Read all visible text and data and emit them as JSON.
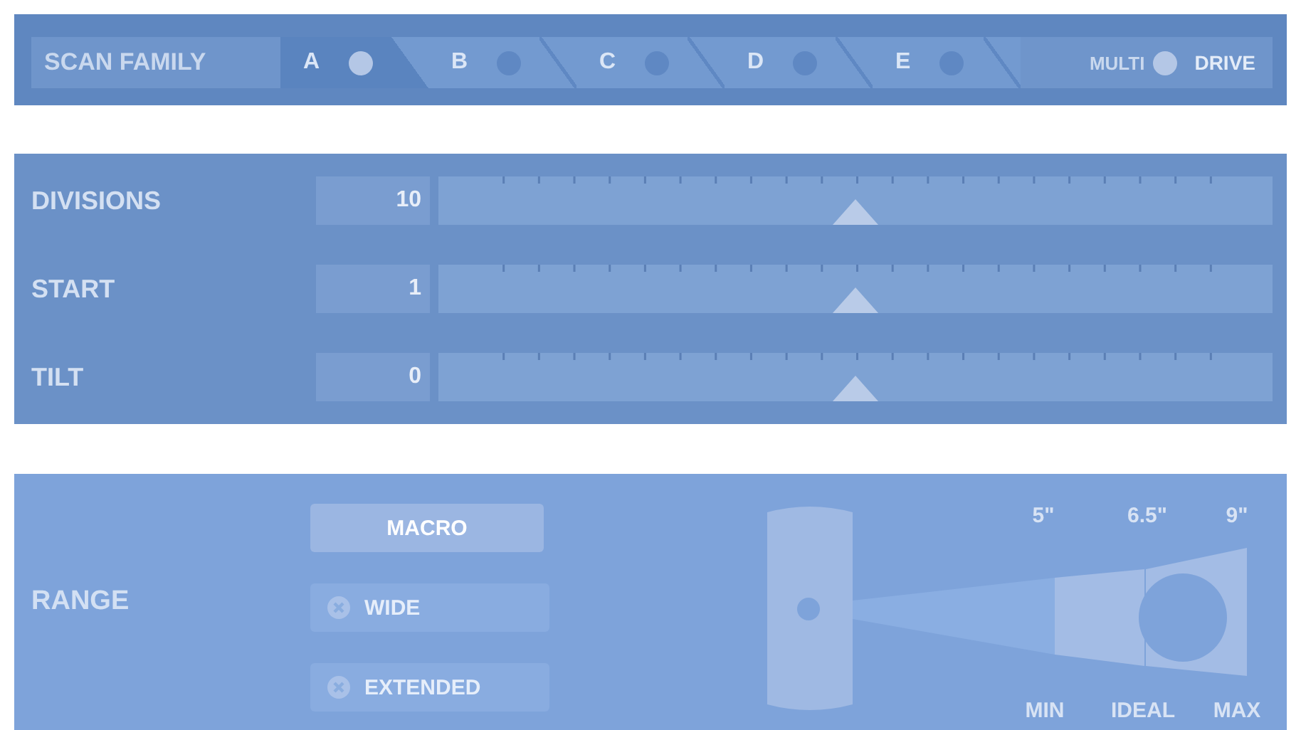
{
  "scan_family": {
    "label": "SCAN FAMILY",
    "tabs": [
      {
        "label": "A",
        "selected": true
      },
      {
        "label": "B",
        "selected": false
      },
      {
        "label": "C",
        "selected": false
      },
      {
        "label": "D",
        "selected": false
      },
      {
        "label": "E",
        "selected": false
      }
    ],
    "multi": {
      "label": "MULTI",
      "on": true
    },
    "drive_label": "DRIVE"
  },
  "sliders": [
    {
      "label": "DIVISIONS",
      "value": "10",
      "level": 0.5
    },
    {
      "label": "START",
      "value": "1",
      "level": 0.5
    },
    {
      "label": "TILT",
      "value": "0",
      "level": 0.5
    }
  ],
  "range": {
    "label": "RANGE",
    "options": [
      {
        "label": "MACRO",
        "selected": true,
        "disabled": false
      },
      {
        "label": "WIDE",
        "selected": false,
        "disabled": true
      },
      {
        "label": "EXTENDED",
        "selected": false,
        "disabled": true
      }
    ],
    "distances": [
      "5\"",
      "6.5\"",
      "9\""
    ],
    "markers": [
      "MIN",
      "IDEAL",
      "MAX"
    ]
  }
}
